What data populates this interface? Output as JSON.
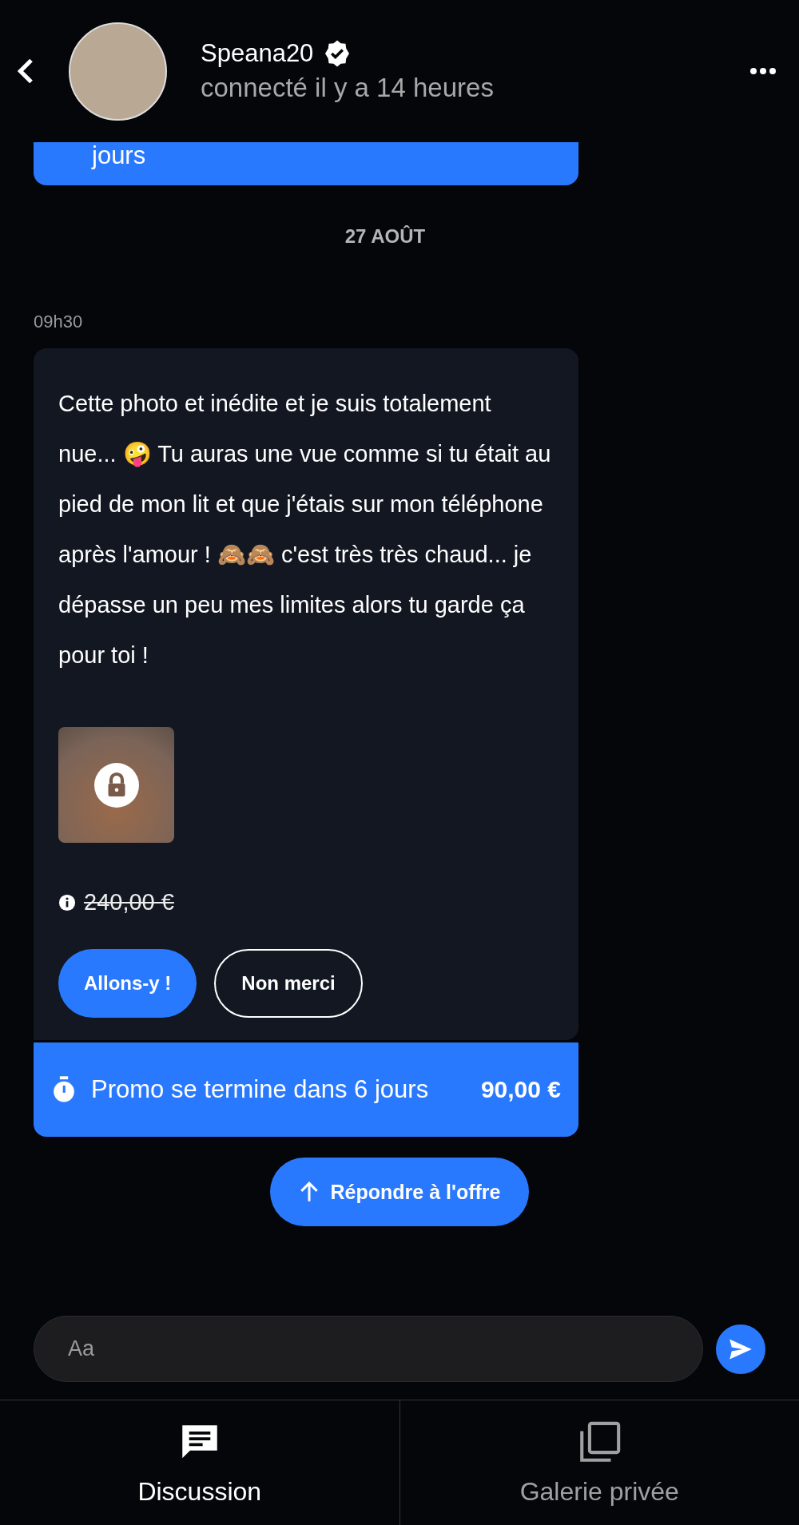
{
  "header": {
    "name": "Speana20",
    "verified": true,
    "status": "connecté il y a 14 heures"
  },
  "previous_promo": {
    "text": "jours"
  },
  "date_separator": "27 AOÛT",
  "message": {
    "time": "09h30",
    "text": "Cette photo et inédite et je suis totalement nue... 🤪 Tu auras une vue comme si tu était au pied de mon lit et que j'étais sur mon téléphone après l'amour ! 🙈🙈 c'est très très chaud... je dépasse un peu mes limites alors tu garde ça pour toi !",
    "locked": true,
    "original_price": "240,00 €",
    "buttons": [
      {
        "label": "Allons-y !",
        "kind": "primary"
      },
      {
        "label": "Non merci",
        "kind": "outline"
      }
    ],
    "promo": {
      "text": "Promo se termine dans 6 jours",
      "price": "90,00 €"
    }
  },
  "reply_button": "Répondre à l'offre",
  "composer": {
    "placeholder": "Aa"
  },
  "tabs": [
    {
      "label": "Discussion",
      "kind": "chat",
      "selected": true
    },
    {
      "label": "Galerie privée",
      "kind": "gallery",
      "selected": false
    }
  ]
}
